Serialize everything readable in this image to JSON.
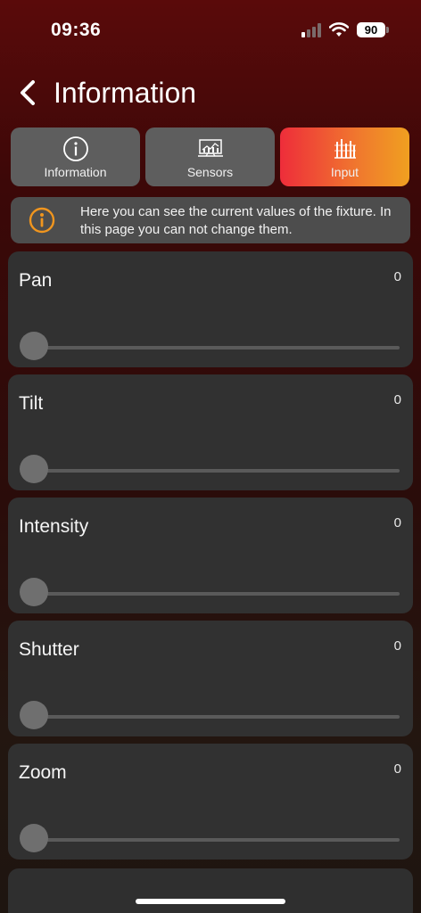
{
  "status_bar": {
    "time": "09:36",
    "battery": "90"
  },
  "nav": {
    "back_icon": "chevron-left-icon",
    "title": "Information"
  },
  "tabs": [
    {
      "label": "Information",
      "icon": "info-circle-icon",
      "active": false
    },
    {
      "label": "Sensors",
      "icon": "monitor-chart-icon",
      "active": false
    },
    {
      "label": "Input",
      "icon": "bar-levels-icon",
      "active": true
    }
  ],
  "notice": {
    "icon": "info-circle-icon",
    "color": "#f0951e",
    "text": "Here you can see the current values of the fixture. In this page you can not change them."
  },
  "channels": [
    {
      "label": "Pan",
      "value": "0",
      "level": 0
    },
    {
      "label": "Tilt",
      "value": "0",
      "level": 0
    },
    {
      "label": "Intensity",
      "value": "0",
      "level": 0
    },
    {
      "label": "Shutter",
      "value": "0",
      "level": 0
    },
    {
      "label": "Zoom",
      "value": "0",
      "level": 0
    }
  ],
  "colors": {
    "accent_gradient_start": "#ee2d3a",
    "accent_gradient_end": "#f0a020",
    "card_background": "#313131",
    "tab_background": "#5e5e5e"
  }
}
